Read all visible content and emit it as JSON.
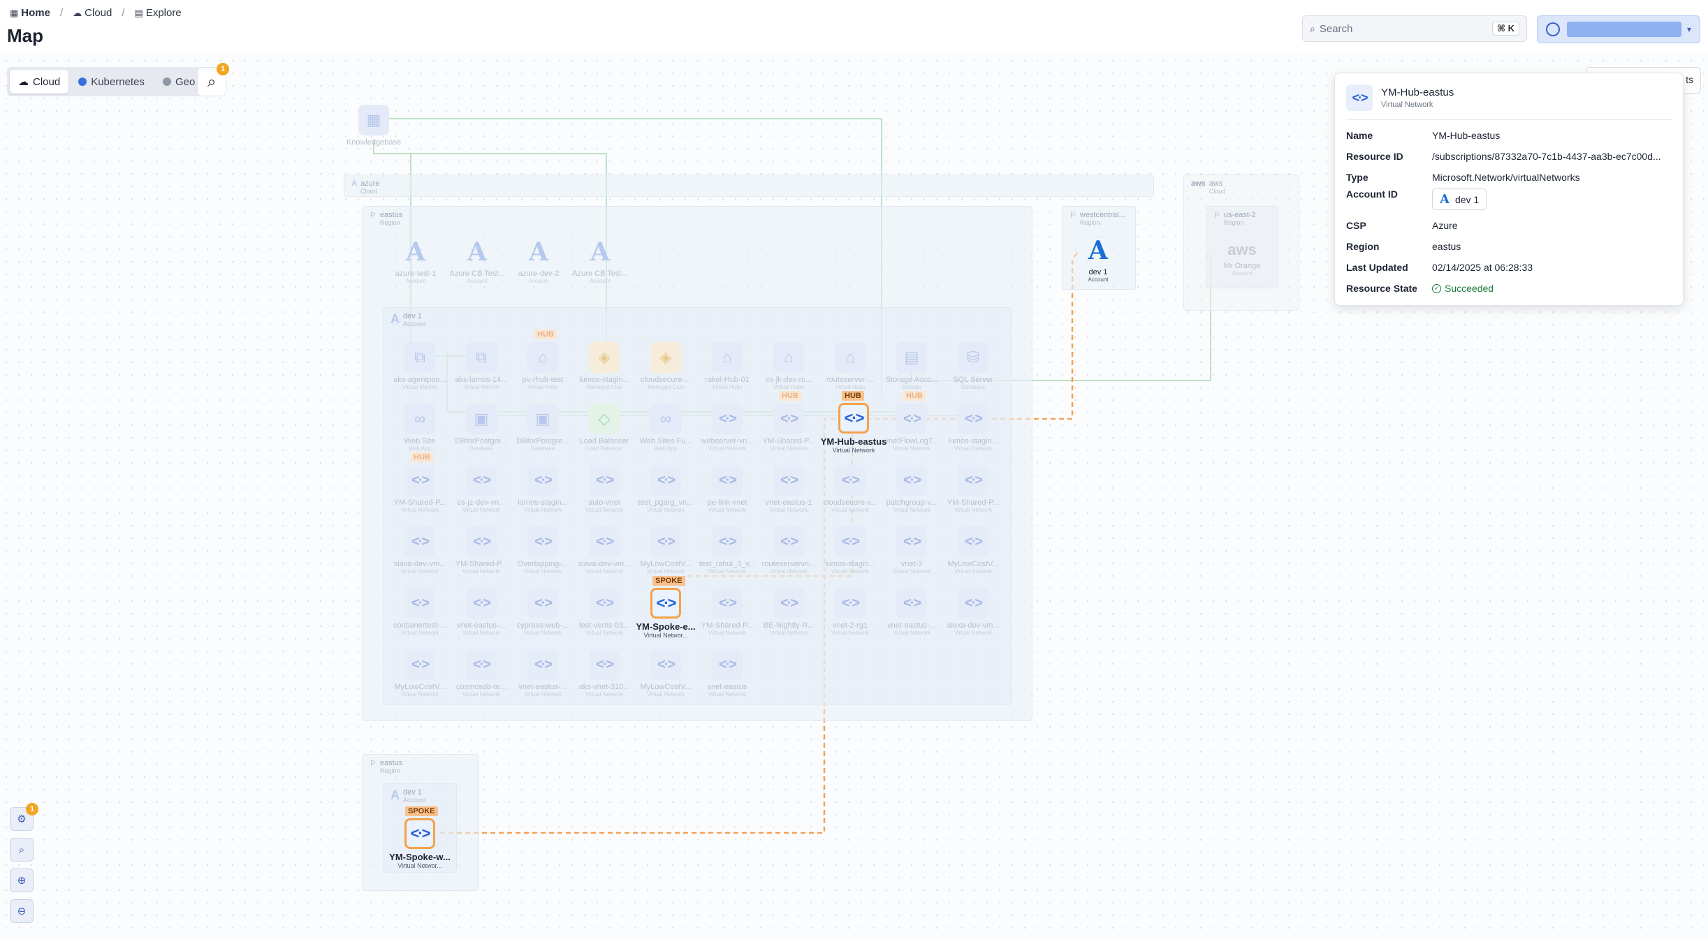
{
  "breadcrumb": {
    "items": [
      {
        "label": "Home",
        "icon": "grid-icon"
      },
      {
        "label": "Cloud",
        "icon": "cloud-icon"
      },
      {
        "label": "Explore",
        "icon": "calendar-icon"
      }
    ],
    "separator": "/"
  },
  "page": {
    "title": "Map"
  },
  "search": {
    "placeholder": "Search",
    "shortcut": "⌘ K"
  },
  "view_toggle": {
    "options": [
      {
        "label": "Cloud",
        "active": true
      },
      {
        "label": "Kubernetes",
        "active": false
      },
      {
        "label": "Geo",
        "active": false
      }
    ]
  },
  "canvas": {
    "search_badge": "1",
    "settings_badge": "1",
    "panel_stub_label": "ts",
    "knowledge_label": "Knowledgebase",
    "regions": {
      "azure": {
        "name": "azure",
        "sub": "Cloud"
      },
      "eastus_top": {
        "name": "eastus",
        "sub": "Region"
      },
      "dev1": {
        "name": "dev 1",
        "sub": "Account"
      },
      "westcentral": {
        "name": "westcentral...",
        "sub": "Region"
      },
      "aws": {
        "name": "aws",
        "sub": "Cloud"
      },
      "us_east": {
        "name": "us-east-2",
        "sub": "Region"
      },
      "eastus_bottom": {
        "name": "eastus",
        "sub": "Region"
      },
      "dev1_bottom": {
        "name": "dev 1",
        "sub": "Account"
      }
    },
    "accounts_row": [
      {
        "label": "azure-test-1",
        "type": "Account"
      },
      {
        "label": "Azure CB Test...",
        "type": "Account"
      },
      {
        "label": "azure-dev-2",
        "type": "Account"
      },
      {
        "label": "Azure CB Test...",
        "type": "Account"
      }
    ],
    "row1": [
      {
        "label": "aks-agentpoo...",
        "type": "Virtual Machin"
      },
      {
        "label": "aks-lamos-14...",
        "type": "Virtual Machin"
      },
      {
        "label": "pv-rhub-test",
        "type": "Virtual Hubs"
      },
      {
        "label": "lumos-stagin...",
        "type": "Managed Clus"
      },
      {
        "label": "cloudsecure-...",
        "type": "Managed Clus"
      },
      {
        "label": "rakel-Hub-01",
        "type": "Virtual Hubs"
      },
      {
        "label": "cs-jk-dev-rc...",
        "type": "Virtual Hubs"
      },
      {
        "label": "routeserver-...",
        "type": "Virtual Hubs"
      },
      {
        "label": "Storage Acco...",
        "type": "Storage"
      },
      {
        "label": "SQL Server",
        "type": "Database"
      }
    ],
    "row2": [
      {
        "label": "Web Site",
        "type": "Web App"
      },
      {
        "label": "DBforPostgre...",
        "type": "Database"
      },
      {
        "label": "DBforPostgre...",
        "type": "Database"
      },
      {
        "label": "Load Balancer",
        "type": "Load Balancer"
      },
      {
        "label": "Web Sites Fu...",
        "type": "Web App"
      },
      {
        "label": "webserver-vn...",
        "type": "Virtual Network"
      },
      {
        "label": "YM-Shared-P...",
        "type": "Virtual Network"
      },
      {
        "label": "YM-Hub-eastus",
        "type": "Virtual Network"
      },
      {
        "label": "vnetFlowLogT...",
        "type": "Virtual Network"
      },
      {
        "label": "lumos-stagin...",
        "type": "Virtual Network"
      }
    ],
    "row3": [
      {
        "label": "YM-Shared-P...",
        "type": "Virtual Network"
      },
      {
        "label": "cs-jz-dev-vn...",
        "type": "Virtual Network"
      },
      {
        "label": "lumos-stagin...",
        "type": "Virtual Network"
      },
      {
        "label": "auto-vnet",
        "type": "Virtual Network"
      },
      {
        "label": "test_pgarg_vn...",
        "type": "Virtual Network"
      },
      {
        "label": "pe-link-vnet",
        "type": "Virtual Network"
      },
      {
        "label": "vnet-eastus-1",
        "type": "Virtual Network"
      },
      {
        "label": "cloudsecure-v...",
        "type": "Virtual Network"
      },
      {
        "label": "patchgroup-v...",
        "type": "Virtual Network"
      },
      {
        "label": "YM-Shared-P...",
        "type": "Virtual Network"
      }
    ],
    "row4": [
      {
        "label": "slava-dev-vm...",
        "type": "Virtual Network"
      },
      {
        "label": "YM-Shared-P...",
        "type": "Virtual Network"
      },
      {
        "label": "Overlapping-...",
        "type": "Virtual Network"
      },
      {
        "label": "slava-dev-vm...",
        "type": "Virtual Network"
      },
      {
        "label": "MyLowCostV...",
        "type": "Virtual Network"
      },
      {
        "label": "test_rahul_3_v...",
        "type": "Virtual Network"
      },
      {
        "label": "routeservervn...",
        "type": "Virtual Network"
      },
      {
        "label": "lumos-stagin...",
        "type": "Virtual Network"
      },
      {
        "label": "vnet-3",
        "type": "Virtual Network"
      },
      {
        "label": "MyLowCostV...",
        "type": "Virtual Network"
      }
    ],
    "row5": [
      {
        "label": "containertest-...",
        "type": "Virtual Network"
      },
      {
        "label": "vnet-eastus-...",
        "type": "Virtual Network"
      },
      {
        "label": "cypress-web-...",
        "type": "Virtual Network"
      },
      {
        "label": "test-vents-03...",
        "type": "Virtual Network"
      },
      {
        "label": "YM-Spoke-e...",
        "type": "Virtual Networ..."
      },
      {
        "label": "YM-Shared-P...",
        "type": "Virtual Network"
      },
      {
        "label": "BE-Nightly-R...",
        "type": "Virtual Network"
      },
      {
        "label": "vnet-2-rg1",
        "type": "Virtual Network"
      },
      {
        "label": "vnet-eastus-...",
        "type": "Virtual Network"
      },
      {
        "label": "alexa-dev-vm...",
        "type": "Virtual Network"
      }
    ],
    "row6": [
      {
        "label": "MyLowCostV...",
        "type": "Virtual Network"
      },
      {
        "label": "cosmosdb-te...",
        "type": "Virtual Network"
      },
      {
        "label": "vnet-eastus-...",
        "type": "Virtual Network"
      },
      {
        "label": "aks-vnet-310...",
        "type": "Virtual Network"
      },
      {
        "label": "MyLowCostV...",
        "type": "Virtual Network"
      },
      {
        "label": "vnet-eastus",
        "type": "Virtual Network"
      }
    ],
    "active_hub": {
      "label": "YM-Hub-eastus",
      "type": "Virtual Network",
      "tag": "HUB"
    },
    "active_spoke": {
      "label": "YM-Spoke-e...",
      "type": "Virtual Networ...",
      "tag": "SPOKE"
    },
    "bottom_spoke": {
      "label": "YM-Spoke-w...",
      "type": "Virtual Networ...",
      "tag": "SPOKE"
    },
    "dev1_account": {
      "label": "dev 1",
      "type": "Account"
    },
    "aws_account": {
      "label": "Mr Orange",
      "type": "Account"
    },
    "hub_tag": "HUB"
  },
  "details": {
    "title": "YM-Hub-eastus",
    "subtitle": "Virtual Network",
    "rows": [
      {
        "key": "Name",
        "value": "YM-Hub-eastus"
      },
      {
        "key": "Resource ID",
        "value": "/subscriptions/87332a70-7c1b-4437-aa3b-ec7c00d..."
      },
      {
        "key": "Type",
        "value": "Microsoft.Network/virtualNetworks"
      },
      {
        "key": "Account ID",
        "value": "dev 1"
      },
      {
        "key": "CSP",
        "value": "Azure"
      },
      {
        "key": "Region",
        "value": "eastus"
      },
      {
        "key": "Last Updated",
        "value": "02/14/2025 at 06:28:33"
      },
      {
        "key": "Resource State",
        "value": "Succeeded"
      }
    ]
  },
  "colors": {
    "accent": "#2563d4",
    "hub_border": "#f4a24a",
    "success": "#197a3a",
    "badge": "#f2a51e"
  }
}
